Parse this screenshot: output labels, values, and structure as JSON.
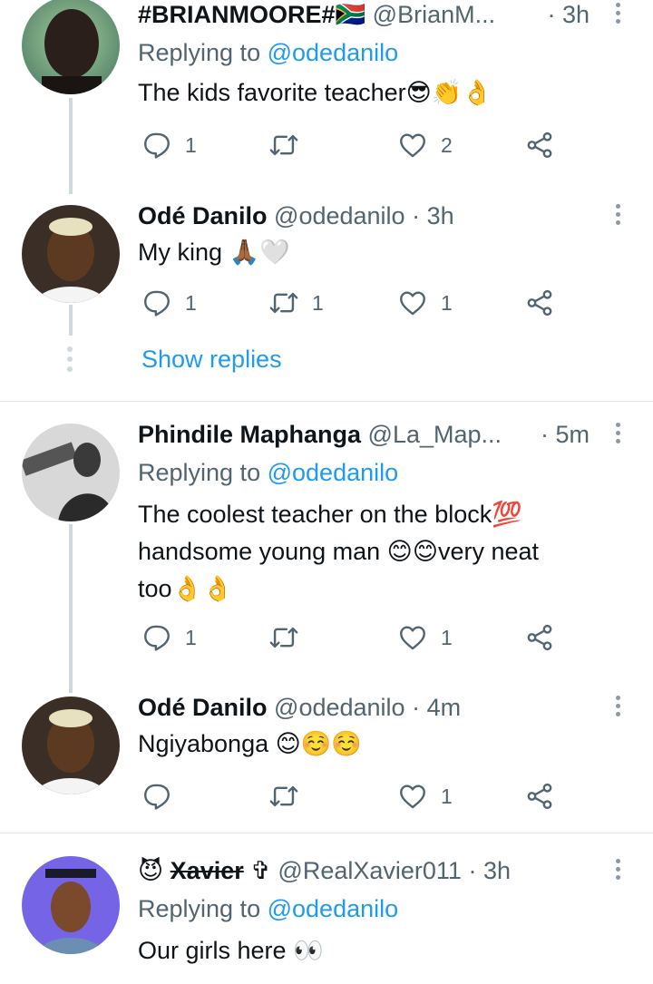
{
  "tweets": [
    {
      "name": "#BRIANMOORE#🇿🇦",
      "handle": "@BrianM...",
      "sep": "·",
      "time": "3h",
      "replying_prefix": "Replying to",
      "replying_to": "@odedanilo",
      "text": "The kids favorite teacher😎👏👌",
      "reply_count": "1",
      "retweet_count": "",
      "like_count": "2"
    },
    {
      "name": "Odé Danilo",
      "handle": "@odedanilo",
      "sep": "·",
      "time": "3h",
      "text": "My king 🙏🏾🤍",
      "reply_count": "1",
      "retweet_count": "1",
      "like_count": "1"
    },
    {
      "name": "Phindile Maphanga",
      "handle": "@La_Map...",
      "sep": "·",
      "time": "5m",
      "replying_prefix": "Replying to",
      "replying_to": "@odedanilo",
      "text_lines": [
        "The coolest teacher on the block💯",
        "handsome young man 😊😊very neat",
        "too👌👌"
      ],
      "reply_count": "1",
      "retweet_count": "",
      "like_count": "1"
    },
    {
      "name": "Odé Danilo",
      "handle": "@odedanilo",
      "sep": "·",
      "time": "4m",
      "text": "Ngiyabonga 😊☺️☺️",
      "reply_count": "",
      "retweet_count": "",
      "like_count": "1"
    },
    {
      "name_prefix": "😈",
      "name": "Xavier",
      "name_suffix": "✞",
      "handle": "@RealXavier011",
      "sep": "·",
      "time": "3h",
      "replying_prefix": "Replying to",
      "replying_to": "@odedanilo",
      "text": "Our girls here 👀"
    }
  ],
  "show_replies": "Show replies",
  "icons": {
    "reply": "reply-icon",
    "retweet": "retweet-icon",
    "like": "like-icon",
    "share": "share-icon",
    "more": "more-options-icon"
  },
  "colors": {
    "link": "#1d9bf0",
    "secondary_text": "#536471",
    "thread_line": "#cfd9de",
    "divider": "#e1e6ea"
  }
}
